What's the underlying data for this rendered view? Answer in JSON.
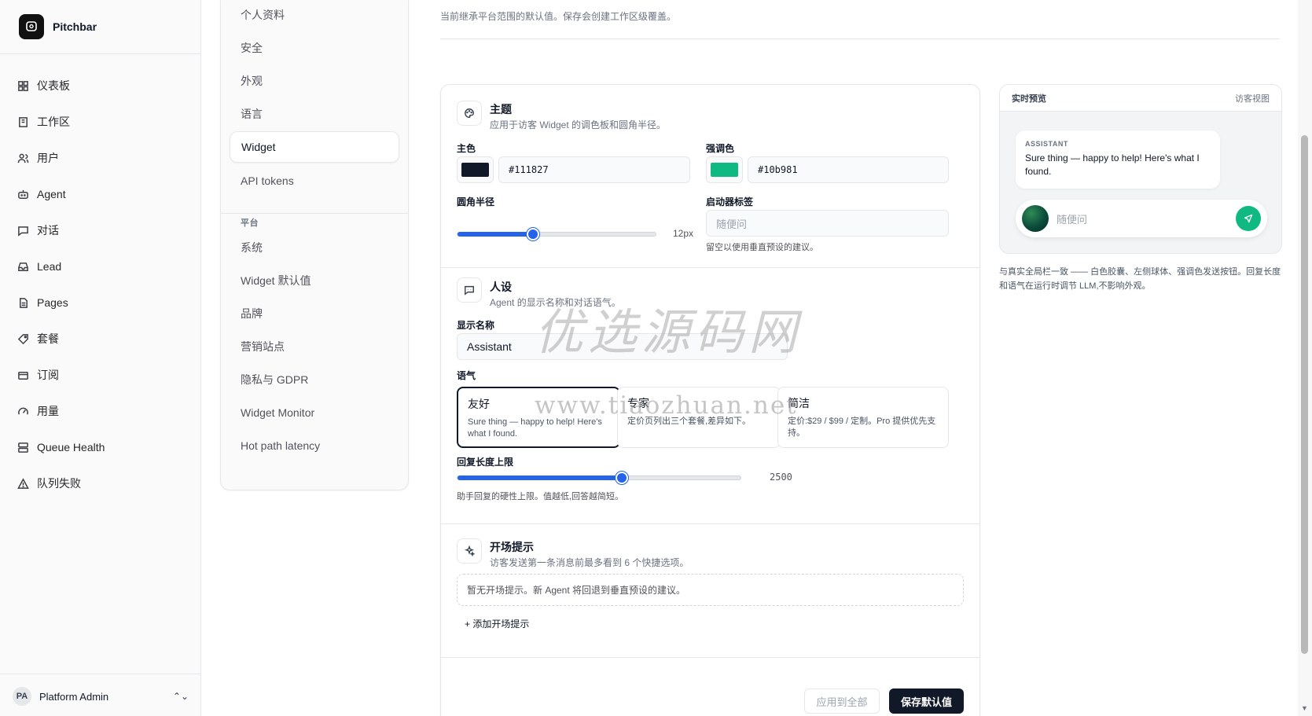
{
  "app": {
    "name": "Pitchbar"
  },
  "sidebar": {
    "items": [
      {
        "label": "仪表板",
        "icon": "dashboard-icon"
      },
      {
        "label": "工作区",
        "icon": "building-icon"
      },
      {
        "label": "用户",
        "icon": "users-icon"
      },
      {
        "label": "Agent",
        "icon": "bot-icon"
      },
      {
        "label": "对话",
        "icon": "chat-icon"
      },
      {
        "label": "Lead",
        "icon": "inbox-icon"
      },
      {
        "label": "Pages",
        "icon": "file-icon"
      },
      {
        "label": "套餐",
        "icon": "tag-icon"
      },
      {
        "label": "订阅",
        "icon": "card-icon"
      },
      {
        "label": "用量",
        "icon": "gauge-icon"
      },
      {
        "label": "Queue Health",
        "icon": "server-icon"
      },
      {
        "label": "队列失败",
        "icon": "alert-icon"
      }
    ],
    "user": {
      "initials": "PA",
      "name": "Platform Admin"
    }
  },
  "settings_nav": {
    "items": [
      {
        "label": "个人资料"
      },
      {
        "label": "安全"
      },
      {
        "label": "外观"
      },
      {
        "label": "语言"
      },
      {
        "label": "Widget",
        "active": true
      },
      {
        "label": "API tokens"
      }
    ],
    "platform_heading": "平台",
    "platform_items": [
      {
        "label": "系统"
      },
      {
        "label": "Widget 默认值"
      },
      {
        "label": "品牌"
      },
      {
        "label": "营销站点"
      },
      {
        "label": "隐私与 GDPR"
      },
      {
        "label": "Widget Monitor"
      },
      {
        "label": "Hot path latency"
      }
    ]
  },
  "header": {
    "description": "当前继承平台范围的默认值。保存会创建工作区级覆盖。"
  },
  "theme": {
    "title": "主题",
    "subtitle": "应用于访客 Widget 的调色板和圆角半径。",
    "primary_label": "主色",
    "primary_value": "#111827",
    "accent_label": "强调色",
    "accent_value": "#10b981",
    "radius_label": "圆角半径",
    "radius_value": "12px",
    "radius_fraction": 0.38,
    "launcher_label": "启动器标签",
    "launcher_placeholder": "随便问",
    "launcher_hint": "留空以使用垂直预设的建议。"
  },
  "persona": {
    "title": "人设",
    "subtitle": "Agent 的显示名称和对话语气。",
    "display_name_label": "显示名称",
    "display_name_value": "Assistant",
    "tone_label": "语气",
    "tones": [
      {
        "title": "友好",
        "desc": "Sure thing — happy to help! Here's what I found.",
        "active": true
      },
      {
        "title": "专家",
        "desc": "定价页列出三个套餐,差异如下。"
      },
      {
        "title": "简洁",
        "desc": "定价:$29 / $99 / 定制。Pro 提供优先支持。"
      }
    ],
    "reply_length_label": "回复长度上限",
    "reply_length_value": "2500",
    "reply_length_fraction": 0.58,
    "reply_length_hint": "助手回复的硬性上限。值越低,回答越简短。"
  },
  "starters": {
    "title": "开场提示",
    "subtitle": "访客发送第一条消息前最多看到 6 个快捷选项。",
    "empty_text": "暂无开场提示。新 Agent 将回退到垂直预设的建议。",
    "add_label": "+ 添加开场提示"
  },
  "actions": {
    "apply_all": "应用到全部",
    "save": "保存默认值"
  },
  "preview": {
    "title": "实时预览",
    "view_label": "访客视图",
    "role": "ASSISTANT",
    "message": "Sure thing — happy to help! Here's what I found.",
    "composer_placeholder": "随便问",
    "note": "与真实全局栏一致 —— 白色胶囊、左侧球体、强调色发送按钮。回复长度和语气在运行时调节 LLM,不影响外观。"
  },
  "watermark": {
    "main": "优选源码网",
    "url": "www.tiaozhuan.net"
  },
  "colors": {
    "primary": "#111827",
    "accent": "#10b981",
    "slider": "#2563eb"
  }
}
